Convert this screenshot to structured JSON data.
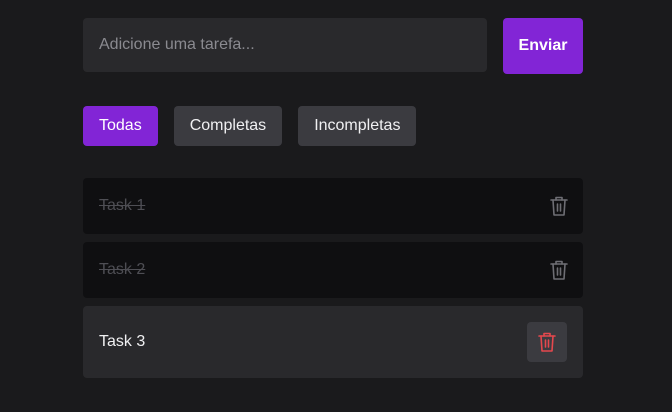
{
  "input": {
    "placeholder": "Adicione uma tarefa...",
    "value": ""
  },
  "send_button": {
    "label": "Enviar"
  },
  "filters": [
    {
      "label": "Todas",
      "active": true
    },
    {
      "label": "Completas",
      "active": false
    },
    {
      "label": "Incompletas",
      "active": false
    }
  ],
  "tasks": [
    {
      "label": "Task 1",
      "completed": true
    },
    {
      "label": "Task 2",
      "completed": true
    },
    {
      "label": "Task 3",
      "completed": false
    }
  ],
  "icons": {
    "delete": "trash-icon"
  },
  "colors": {
    "accent": "#8225d6",
    "background": "#1a1a1c",
    "delete_active": "#e5484d",
    "delete_muted": "#6e6e74"
  }
}
